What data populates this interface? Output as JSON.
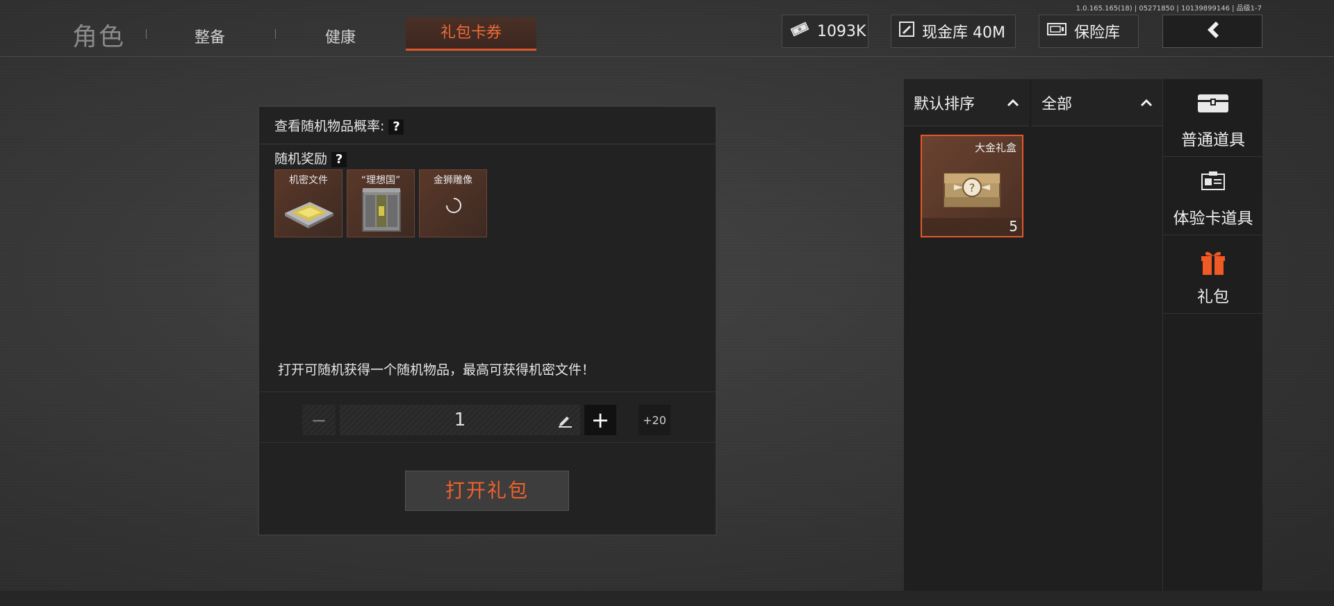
{
  "version": "1.0.165.165(18) | 05271850 | 10139899146 | 品级1-7",
  "topbar": {
    "title": "角色",
    "tabs": [
      {
        "label": "整备"
      },
      {
        "label": "健康"
      },
      {
        "label": "礼包卡券"
      }
    ],
    "currency": {
      "bills": "1093K",
      "cash_vault": "现金库 40M",
      "safe": "保险库"
    }
  },
  "card": {
    "header": "查看随机物品概率:",
    "header_badge": "?",
    "reward_title": "随机奖励",
    "reward_badge": "?",
    "rewards": [
      {
        "label": "机密文件"
      },
      {
        "label": "“理想国”"
      },
      {
        "label": "金狮雕像"
      }
    ],
    "description": "打开可随机获得一个随机物品，最高可获得机密文件！",
    "quantity": "1",
    "minus": "−",
    "plus": "+",
    "plus20": "+20",
    "open_button": "打开礼包"
  },
  "inventory": {
    "sort_label": "默认排序",
    "filter_label": "全部",
    "items": [
      {
        "name": "大金礼盒",
        "count": "5"
      }
    ]
  },
  "categories": [
    {
      "label": "普通道具",
      "icon": "chest-icon"
    },
    {
      "label": "体验卡道具",
      "icon": "id-card-icon"
    },
    {
      "label": "礼包",
      "icon": "gift-icon",
      "active": true
    }
  ],
  "colors": {
    "accent": "#e2572a",
    "active_tab_text": "#f06a35"
  }
}
